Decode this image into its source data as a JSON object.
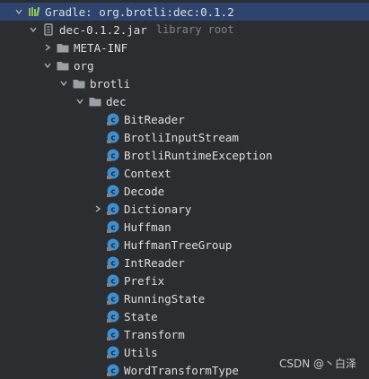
{
  "root": {
    "label": "Gradle: org.brotli:dec:0.1.2"
  },
  "jar": {
    "label": "dec-0.1.2.jar",
    "sub": "library root"
  },
  "folders": {
    "meta_inf": "META-INF",
    "org": "org",
    "brotli": "brotli",
    "dec": "dec"
  },
  "classes": [
    "BitReader",
    "BrotliInputStream",
    "BrotliRuntimeException",
    "Context",
    "Decode",
    "Dictionary",
    "Huffman",
    "HuffmanTreeGroup",
    "IntReader",
    "Prefix",
    "RunningState",
    "State",
    "Transform",
    "Utils",
    "WordTransformType"
  ],
  "watermark": "CSDN @丶白泽",
  "colors": {
    "background": "#2b2d30",
    "selection": "#2e436e",
    "class_icon": "#3f8fd0",
    "folder": "#9aa0a6",
    "muted_text": "#7f8389"
  }
}
